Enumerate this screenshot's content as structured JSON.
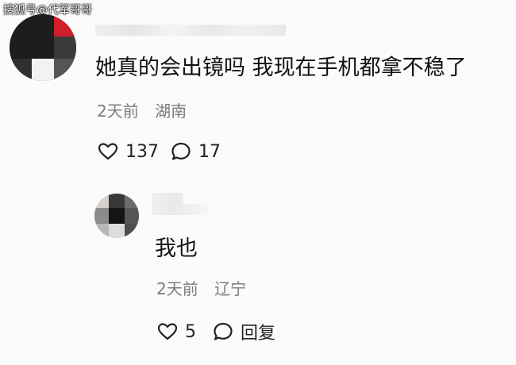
{
  "watermark": {
    "text": "搜狐号@代军哥哥"
  },
  "comment": {
    "text": "她真的会出镜吗 我现在手机都拿不稳了",
    "time": "2天前",
    "location": "湖南",
    "like_count": "137",
    "reply_count": "17",
    "icons": {
      "like": "heart-icon",
      "comment": "comment-bubble-icon"
    }
  },
  "reply": {
    "text": "我也",
    "time": "2天前",
    "location": "辽宁",
    "like_count": "5",
    "reply_label": "回复",
    "icons": {
      "like": "heart-icon",
      "reply": "comment-bubble-icon"
    }
  }
}
